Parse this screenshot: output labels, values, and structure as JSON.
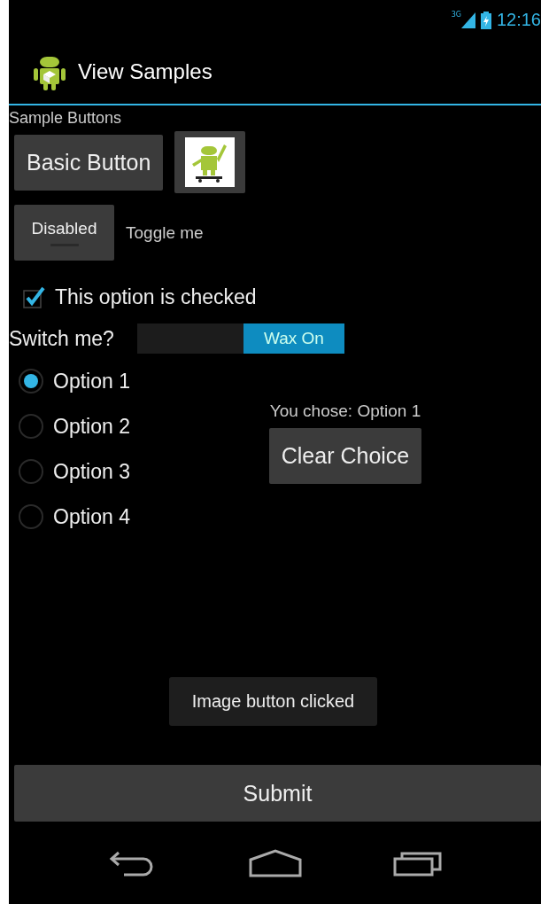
{
  "status_bar": {
    "network": "3G",
    "time": "12:16"
  },
  "action_bar": {
    "title": "View Samples"
  },
  "section_label": "Sample Buttons",
  "basic_button": "Basic Button",
  "toggle": {
    "label": "Disabled",
    "on": false
  },
  "toggle_caption": "Toggle me",
  "checkbox": {
    "label": "This option is checked",
    "checked": true
  },
  "switch": {
    "label": "Switch me?",
    "on": true,
    "on_text": "Wax On"
  },
  "radios": [
    {
      "label": "Option 1",
      "selected": true
    },
    {
      "label": "Option 2",
      "selected": false
    },
    {
      "label": "Option 3",
      "selected": false
    },
    {
      "label": "Option 4",
      "selected": false
    }
  ],
  "choice_text": "You chose: Option 1",
  "clear_button": "Clear Choice",
  "toast": "Image button clicked",
  "submit_button": "Submit"
}
